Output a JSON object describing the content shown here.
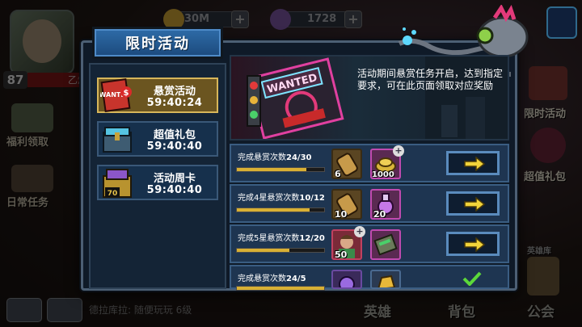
{
  "topbar": {
    "currency1": "30M",
    "currency2": "1728"
  },
  "player": {
    "level": "87",
    "name": "乙烯"
  },
  "left_side_menu": [
    {
      "label": "福利领取"
    },
    {
      "label": "日常任务"
    }
  ],
  "right_side_menu": [
    {
      "label": "限时活动"
    },
    {
      "label": "超值礼包"
    },
    {
      "label": "英雄库"
    }
  ],
  "chat": {
    "text": "德拉库拉: 随便玩玩 6级"
  },
  "bottom_nav": [
    {
      "label": "英雄"
    },
    {
      "label": "背包"
    },
    {
      "label": "公会"
    }
  ],
  "modal": {
    "title": "限时活动",
    "tabs": [
      {
        "name": "悬赏活动",
        "timer": "59:40:24",
        "active": true,
        "icon": "wanted-poster-icon"
      },
      {
        "name": "超值礼包",
        "timer": "59:40:40",
        "active": false,
        "icon": "gift-chest-icon"
      },
      {
        "name": "活动周卡",
        "timer": "59:40:40",
        "active": false,
        "icon": "weekly-card-chest-icon"
      }
    ],
    "banner": {
      "description": "活动期间悬赏任务开启，达到指定要求，可在此页面领取对应奖励"
    },
    "tasks": [
      {
        "prefix": "完成悬赏次数",
        "progress_text": "24/30",
        "progress": 0.8,
        "rewards": [
          {
            "icon": "bullet-scroll-icon",
            "count": "6"
          },
          {
            "icon": "gold-coin-pile-icon",
            "count": "1000",
            "has_plus": true
          }
        ],
        "state": "go"
      },
      {
        "prefix": "完成4星悬赏次数",
        "progress_text": "10/12",
        "progress": 0.83,
        "rewards": [
          {
            "icon": "bullet-scroll-icon",
            "count": "10"
          },
          {
            "icon": "potion-flask-icon",
            "count": "20"
          }
        ],
        "state": "go"
      },
      {
        "prefix": "完成5星悬赏次数",
        "progress_text": "12/20",
        "progress": 0.6,
        "rewards": [
          {
            "icon": "hero-portrait-icon",
            "count": "50",
            "has_plus": true
          },
          {
            "icon": "supply-crate-icon",
            "count": ""
          }
        ],
        "state": "go"
      },
      {
        "prefix": "完成悬赏次数",
        "progress_text": "24/5",
        "progress": 1.0,
        "rewards": [
          {
            "icon": "purple-gem-icon",
            "count": ""
          },
          {
            "icon": "gold-ore-icon",
            "count": ""
          }
        ],
        "state": "done"
      }
    ]
  },
  "colors": {
    "active_tab": "#6b5520",
    "tab": "#16304c",
    "row": "#1e3551",
    "progress_fill": "#d8b034",
    "title_tab": "#2e6ba8"
  }
}
